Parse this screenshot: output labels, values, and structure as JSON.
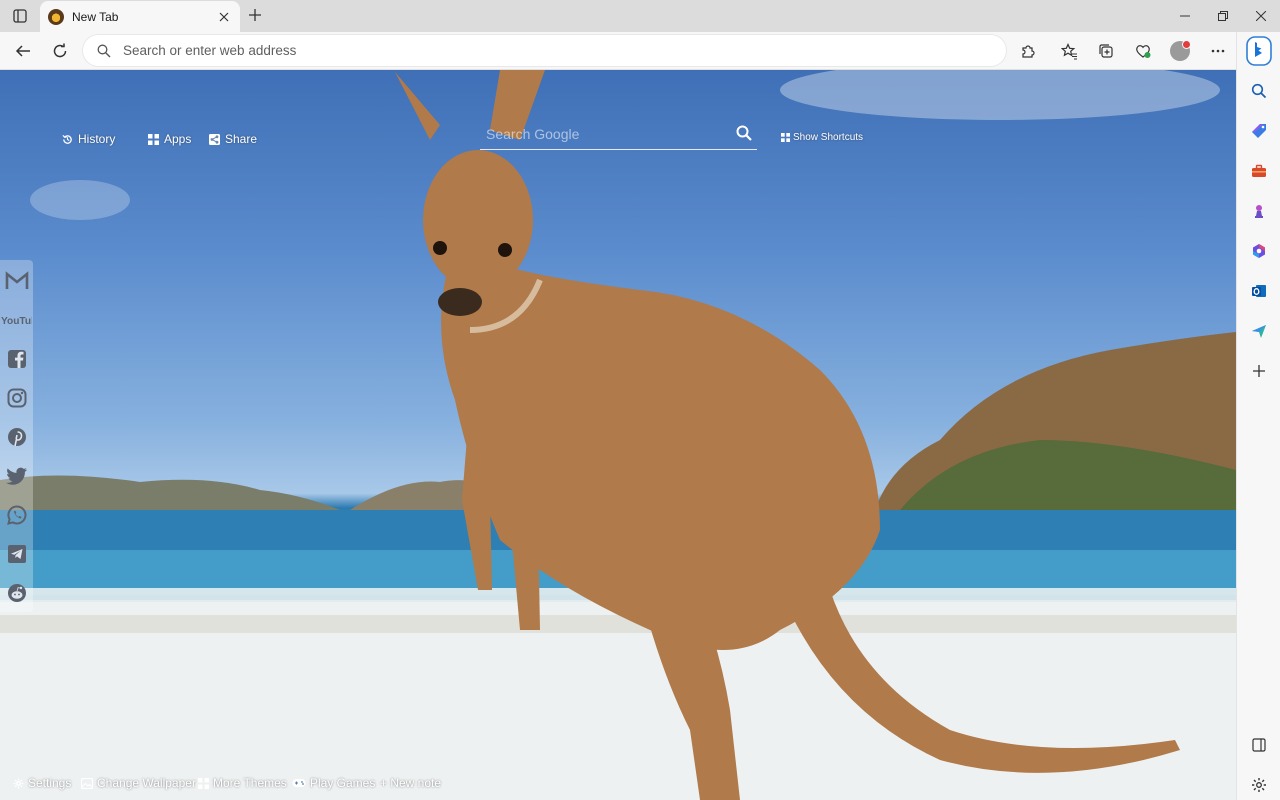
{
  "browser": {
    "tab": {
      "title": "New Tab",
      "favicon": "kangaroo-favicon"
    },
    "address_bar": {
      "placeholder": "Search or enter web address",
      "value": ""
    }
  },
  "newtab": {
    "top_links": {
      "history": "History",
      "apps": "Apps",
      "share": "Share",
      "show_shortcuts": "Show Shortcuts"
    },
    "search": {
      "placeholder": "Search Google"
    },
    "social": [
      "gmail-icon",
      "youtube-icon",
      "facebook-icon",
      "instagram-icon",
      "pinterest-icon",
      "twitter-icon",
      "whatsapp-icon",
      "telegram-icon",
      "reddit-icon"
    ],
    "youtube_label": "YouTube",
    "bottom_links": {
      "settings": "Settings",
      "change_wallpaper": "Change Wallpaper",
      "more_themes": "More Themes",
      "play_games": "Play Games",
      "new_note": "+ New note"
    },
    "wallpaper": "kangaroo on beach"
  },
  "colors": {
    "tabbar_bg": "#dcdcdc",
    "toolbar_bg": "#f7f7f7",
    "sky": "#4a7cc0",
    "sea": "#2c7ab0",
    "sand": "#f1f3f4",
    "kangaroo": "#b07a4a"
  }
}
